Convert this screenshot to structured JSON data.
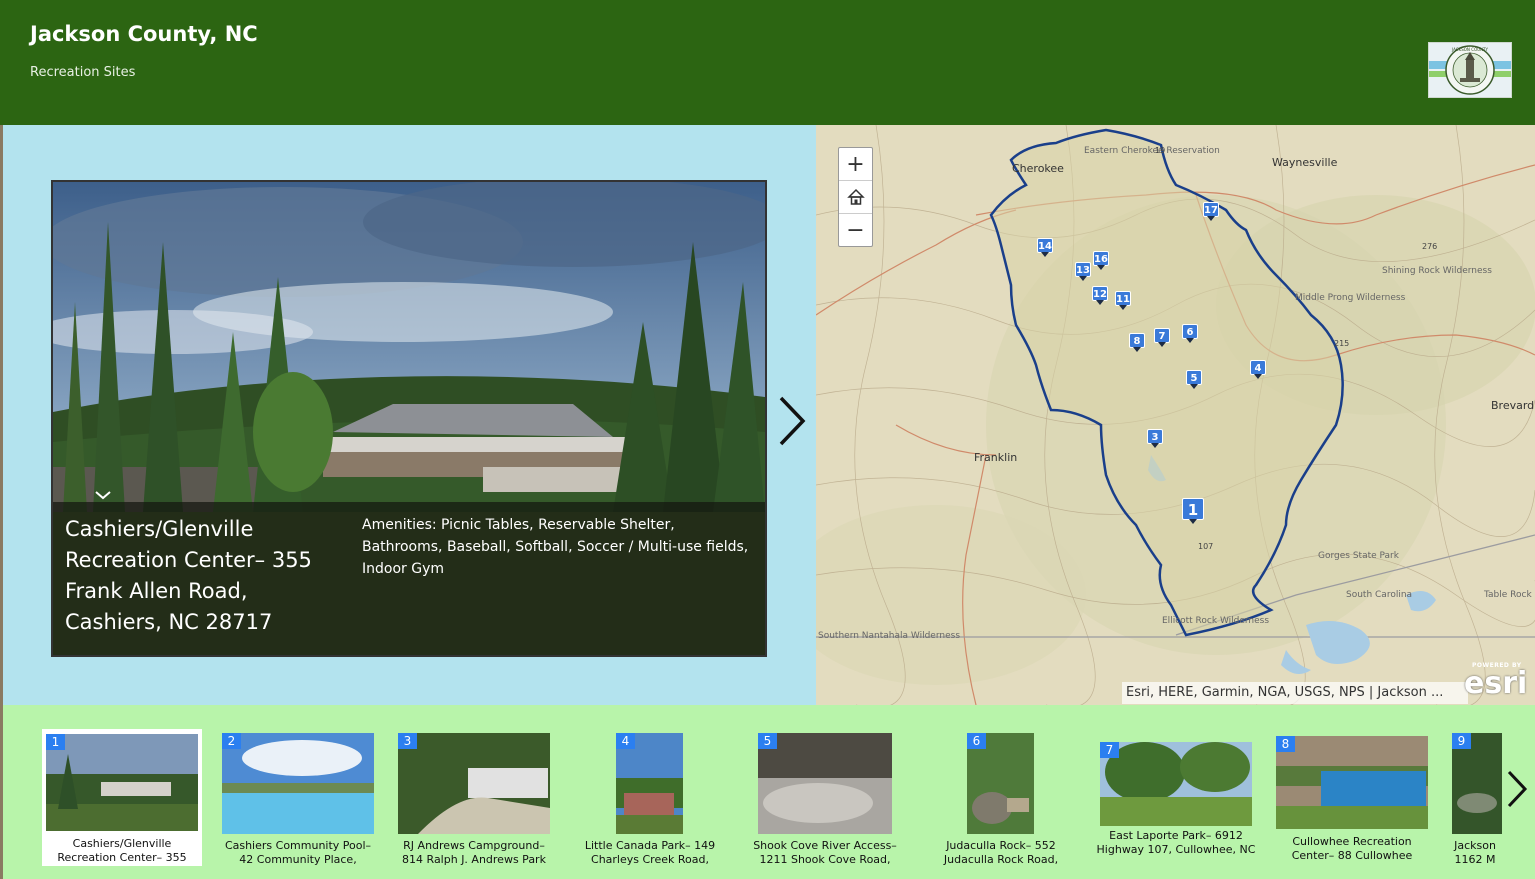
{
  "header": {
    "title": "Jackson County, NC",
    "subtitle": "Recreation Sites",
    "logo_icon": "jackson-county-seal"
  },
  "feature": {
    "number": "1",
    "title": "Cashiers/Glenville Recreation Center– 355 Frank Allen Road, Cashiers, NC 28717",
    "description": "Amenities: Picnic Tables, Reservable Shelter, Bathrooms, Baseball, Softball, Soccer / Multi-use fields, Indoor Gym"
  },
  "map": {
    "zoom_in": "+",
    "zoom_out": "−",
    "home_icon": "home-icon",
    "attribution": "Esri, HERE, Garmin, NGA, USGS, NPS | Jackson ...",
    "esri_powered": "POWERED BY",
    "esri_logo": "esri",
    "place_labels": [
      "Cherokee",
      "Eastern Cherokee Reservation",
      "Waynesville",
      "Shining Rock Wilderness",
      "Middle Prong Wilderness",
      "Brevard",
      "Franklin",
      "Gorges State Park",
      "Table Rock State Park",
      "Southern Nantahala Wilderness",
      "Ellicott Rock Wilderness",
      "South Carolina",
      "19",
      "276",
      "215",
      "107"
    ],
    "markers": [
      "1",
      "3",
      "4",
      "5",
      "6",
      "7",
      "8",
      "11",
      "12",
      "13",
      "14",
      "16",
      "17"
    ]
  },
  "carousel": {
    "items": [
      {
        "num": "1",
        "caption": "Cashiers/Glenville Recreation Center– 355"
      },
      {
        "num": "2",
        "caption": "Cashiers Community Pool– 42 Community Place,"
      },
      {
        "num": "3",
        "caption": "RJ Andrews Campground– 814 Ralph J. Andrews Park"
      },
      {
        "num": "4",
        "caption": "Little Canada Park– 149 Charleys Creek Road,"
      },
      {
        "num": "5",
        "caption": "Shook Cove River Access– 1211 Shook Cove Road,"
      },
      {
        "num": "6",
        "caption": "Judaculla Rock– 552 Judaculla Rock Road,"
      },
      {
        "num": "7",
        "caption": "East Laporte Park– 6912 Highway 107, Cullowhee, NC"
      },
      {
        "num": "8",
        "caption": "Cullowhee Recreation Center– 88 Cullowhee"
      },
      {
        "num": "9",
        "caption": "Jackson 1162 M"
      }
    ],
    "next_icon": "chevron-right-icon"
  },
  "colors": {
    "header": "#2c6512",
    "media_bg": "#b3e3ee",
    "carousel_bg": "#b8f4aa",
    "marker": "#3a7ad9",
    "county_boundary": "#1a3f8a"
  }
}
